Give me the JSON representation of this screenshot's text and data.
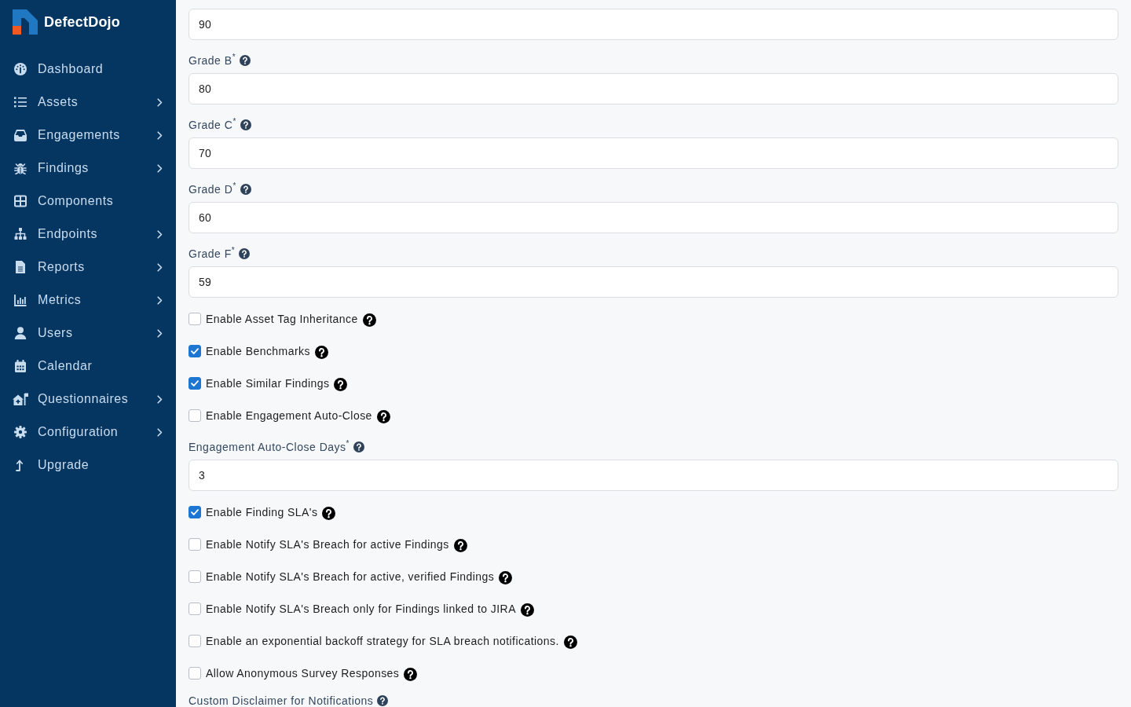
{
  "brand": {
    "name": "DefectDojo"
  },
  "nav": [
    {
      "label": "Dashboard",
      "submenu": false,
      "selected": false
    },
    {
      "label": "Assets",
      "submenu": true,
      "selected": false
    },
    {
      "label": "Engagements",
      "submenu": true,
      "selected": false
    },
    {
      "label": "Findings",
      "submenu": true,
      "selected": false
    },
    {
      "label": "Components",
      "submenu": false,
      "selected": false
    },
    {
      "label": "Endpoints",
      "submenu": true,
      "selected": false
    },
    {
      "label": "Reports",
      "submenu": true,
      "selected": false
    },
    {
      "label": "Metrics",
      "submenu": true,
      "selected": false
    },
    {
      "label": "Users",
      "submenu": true,
      "selected": false
    },
    {
      "label": "Calendar",
      "submenu": false,
      "selected": false
    },
    {
      "label": "Questionnaires",
      "submenu": true,
      "selected": false
    },
    {
      "label": "Configuration",
      "submenu": true,
      "selected": false
    },
    {
      "label": "Upgrade",
      "submenu": false,
      "selected": false
    }
  ],
  "form": {
    "fields": [
      {
        "kind": "number",
        "value": "90"
      },
      {
        "kind": "number",
        "label": "Grade B$^{*}$",
        "value": "80"
      },
      {
        "kind": "number",
        "label": "Grade C$^{*}$",
        "value": "70"
      },
      {
        "kind": "number",
        "label": "Grade D$^{*}$",
        "value": "60"
      },
      {
        "kind": "number",
        "label": "Grade F$^{*}$",
        "value": "59"
      },
      {
        "kind": "checkbox",
        "label": "Enable Asset Tag Inheritance",
        "checked": false
      },
      {
        "kind": "checkbox",
        "label": "Enable Benchmarks",
        "checked": true
      },
      {
        "kind": "checkbox",
        "label": "Enable Similar Findings",
        "checked": true
      },
      {
        "kind": "checkbox",
        "label": "Enable Engagement Auto-Close",
        "checked": false
      },
      {
        "kind": "number",
        "label": "Engagement Auto-Close Days$^{*}$",
        "value": "3"
      },
      {
        "kind": "checkbox",
        "label": "Enable Finding SLA's",
        "checked": true
      },
      {
        "kind": "checkbox",
        "label": "Enable Notify SLA's Breach for active Findings",
        "checked": false
      },
      {
        "kind": "checkbox",
        "label": "Enable Notify SLA's Breach for active, verified Findings",
        "checked": false
      },
      {
        "kind": "checkbox",
        "label": "Enable Notify SLA's Breach only for Findings linked to JIRA",
        "checked": false
      },
      {
        "kind": "checkbox",
        "label": "Enable an exponential backoff strategy for SLA breach notifications.",
        "checked": false
      },
      {
        "kind": "checkbox",
        "label": "Allow Anonymous Survey Responses",
        "checked": false
      },
      {
        "kind": "label",
        "label": "Custom Disclaimer for Notifications"
      }
    ]
  }
}
